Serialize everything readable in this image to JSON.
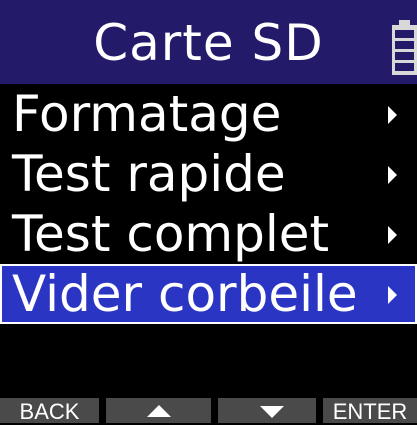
{
  "header": {
    "title": "Carte SD",
    "icon": "battery-icon"
  },
  "menu": {
    "items": [
      {
        "label": "Formatage"
      },
      {
        "label": "Test rapide"
      },
      {
        "label": "Test complet"
      },
      {
        "label": "Vider corbeile"
      }
    ],
    "selected_index": 3
  },
  "softkeys": {
    "back": "BACK",
    "up_icon": "arrow-up-icon",
    "down_icon": "arrow-down-icon",
    "enter": "ENTER"
  },
  "colors": {
    "header_bg": "#241a6a",
    "selected_bg": "#2a35c4",
    "softkey_bg": "#4a4a4a",
    "text": "#ffffff"
  }
}
